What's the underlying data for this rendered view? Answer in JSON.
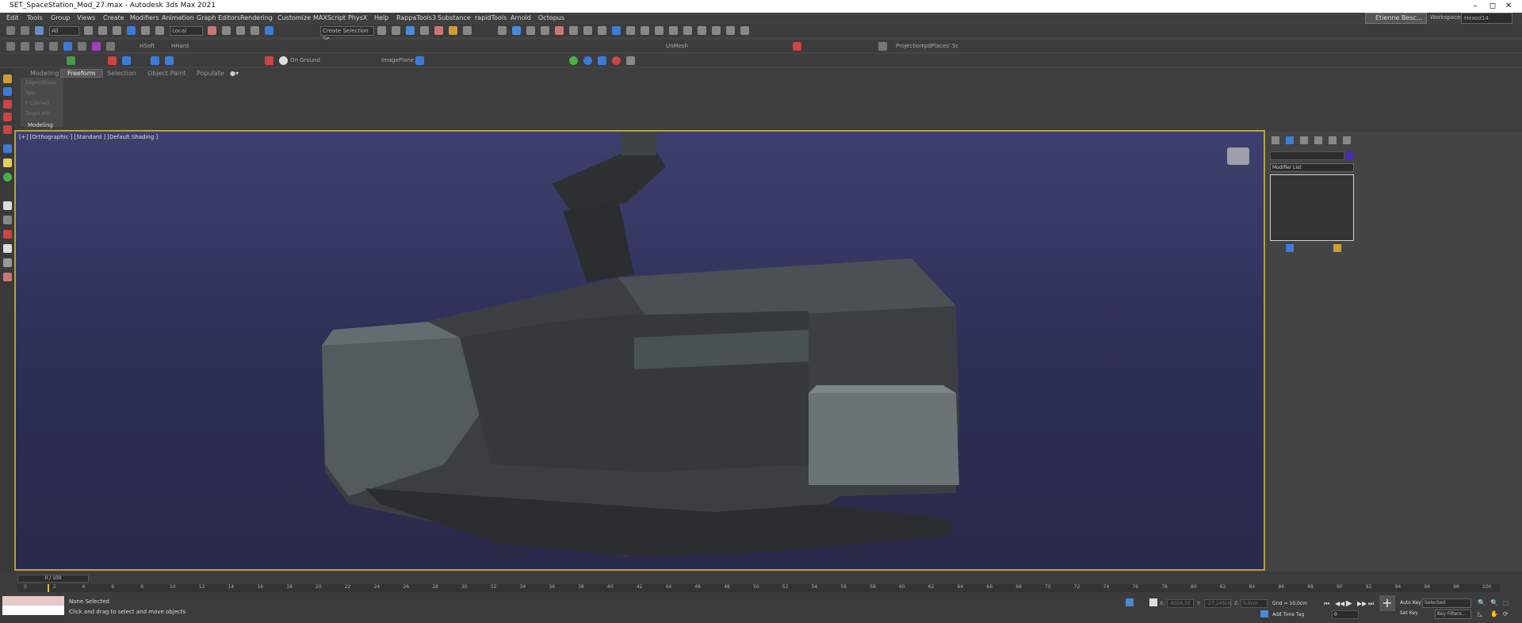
{
  "window": {
    "title": "SET_SpaceStation_Mod_27.max - Autodesk 3ds Max 2021",
    "minimize": "–",
    "maximize": "◻",
    "close": "✕"
  },
  "menu": [
    "Edit",
    "Tools",
    "Group",
    "Views",
    "Create",
    "Modifiers",
    "Animation",
    "Graph Editors",
    "Rendering",
    "Customize",
    "MAXScript",
    "PhysX",
    "Help",
    "RappaTools3",
    "Substance",
    "rapidTools",
    "Arnold",
    "Octopus"
  ],
  "user": {
    "name": "Etienne Besc...",
    "workspaces_label": "Workspaces:",
    "workspace": "Hexod14"
  },
  "toolbar": {
    "filter": "All",
    "coord_system": "Local",
    "selection_set": "Create Selection Se",
    "hsoft": "HSoft",
    "hhard": "HHard",
    "unmesh": "UnMesh",
    "projection": "Projection",
    "multi": "rpdPlaces' Sc",
    "on_ground": "On Ground",
    "imageplane": "ImagePlane"
  },
  "ribbon": {
    "tabs": [
      "Modeling",
      "Freeform",
      "Selection",
      "Object Paint",
      "Populate"
    ],
    "active_tab": "Freeform",
    "items": [
      "Edges/Shape",
      "Spin",
      "P Connect",
      "Target Wts"
    ],
    "panel_label": "Modeling"
  },
  "viewport": {
    "label": "[+] [Orthographic ] [Standard ] [Default Shading ]"
  },
  "command_panel": {
    "modifier_list": "Modifier List",
    "swatch_color": "#4a2ab0"
  },
  "timeline": {
    "frame": "0 / 100",
    "ticks": [
      "0",
      "2",
      "4",
      "6",
      "8",
      "10",
      "12",
      "14",
      "16",
      "18",
      "20",
      "22",
      "24",
      "26",
      "28",
      "30",
      "32",
      "34",
      "36",
      "38",
      "40",
      "42",
      "44",
      "46",
      "48",
      "50",
      "52",
      "54",
      "56",
      "58",
      "60",
      "62",
      "64",
      "66",
      "68",
      "70",
      "72",
      "74",
      "76",
      "78",
      "80",
      "82",
      "84",
      "86",
      "88",
      "90",
      "92",
      "94",
      "96",
      "98",
      "100"
    ]
  },
  "status": {
    "selection": "None Selected",
    "prompt": "Click and drag to select and move objects",
    "x_label": "X:",
    "x_value": "-6026,55",
    "y_label": "Y:",
    "y_value": "-27,245cm",
    "z_label": "Z:",
    "z_value": "0,0cm",
    "grid": "Grid = 10,0cm",
    "add_time_tag": "Add Time Tag",
    "auto_key": "Auto Key",
    "set_key": "Set Key",
    "selected": "Selected",
    "key_filters": "Key Filters...",
    "current_frame": "0"
  }
}
